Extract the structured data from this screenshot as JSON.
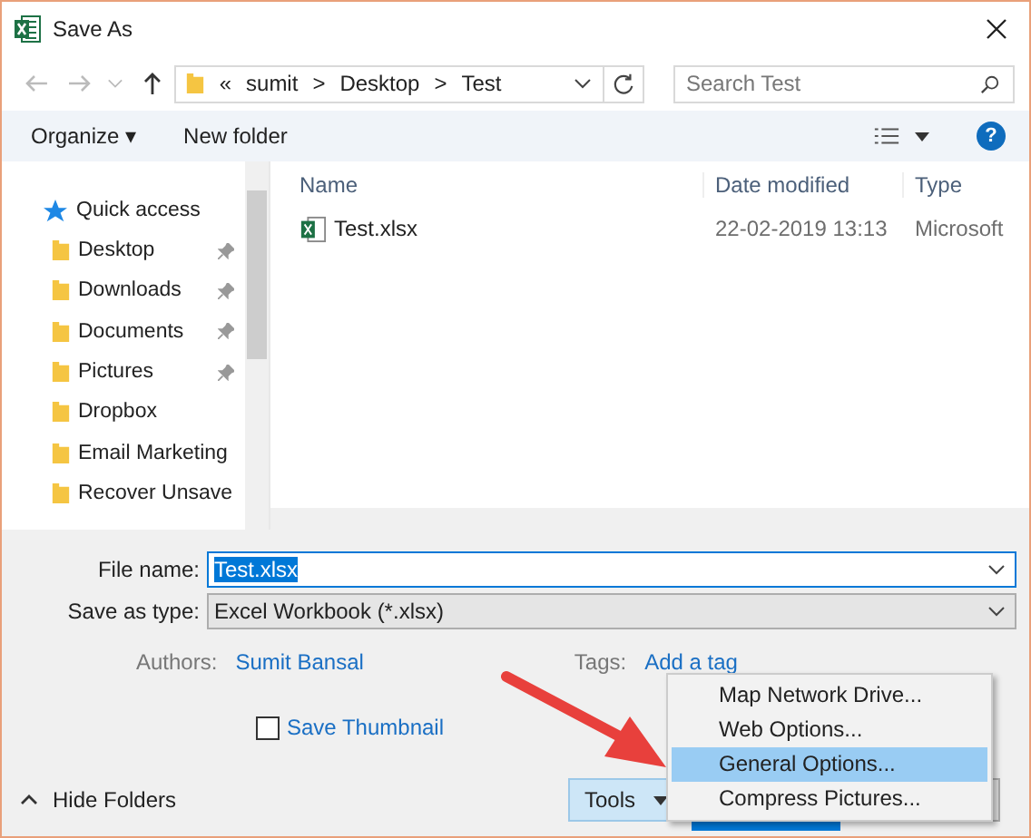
{
  "window": {
    "title": "Save As"
  },
  "address": {
    "crumbs": [
      "«",
      "sumit",
      ">",
      "Desktop",
      ">",
      "Test"
    ]
  },
  "search": {
    "placeholder": "Search Test"
  },
  "toolbar": {
    "buttons": [
      "Organize ▾",
      "New folder"
    ],
    "help": "?"
  },
  "sidebar": {
    "heading": "Quick access",
    "items": [
      {
        "label": "Desktop",
        "pinned": true
      },
      {
        "label": "Downloads",
        "pinned": true
      },
      {
        "label": "Documents",
        "pinned": true
      },
      {
        "label": "Pictures",
        "pinned": true
      },
      {
        "label": "Dropbox",
        "pinned": false
      },
      {
        "label": "Email Marketing",
        "pinned": false
      },
      {
        "label": "Recover Unsave",
        "pinned": false
      }
    ]
  },
  "table": {
    "columns": [
      "Name",
      "Date modified",
      "Type"
    ],
    "rows": [
      {
        "name": "Test.xlsx",
        "date": "22-02-2019 13:13",
        "type": "Microsoft"
      }
    ]
  },
  "form": {
    "file_name_label": "File name:",
    "file_name": "Test.xlsx",
    "type_label": "Save as type:",
    "type": "Excel Workbook (*.xlsx)",
    "authors_label": "Authors:",
    "authors": "Sumit Bansal",
    "tags_label": "Tags:",
    "tags": "Add a tag",
    "thumbnail": {
      "label": "Save Thumbnail",
      "checked": false
    }
  },
  "footer": {
    "hide_folders": "Hide Folders",
    "tools": "Tools"
  },
  "menu": {
    "items": [
      {
        "label": "Map Network Drive...",
        "selected": false
      },
      {
        "label": "Web Options...",
        "selected": false
      },
      {
        "label": "General Options...",
        "selected": true
      },
      {
        "label": "Compress Pictures...",
        "selected": false
      }
    ]
  }
}
